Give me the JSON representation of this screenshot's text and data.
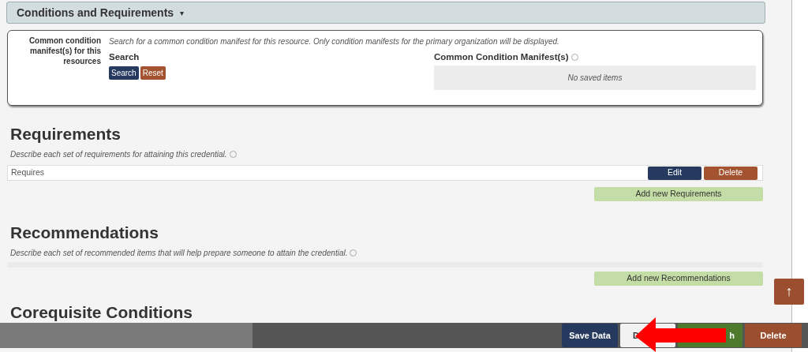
{
  "section_header": {
    "title": "Conditions and Requirements",
    "caret": "▾"
  },
  "manifest_card": {
    "label": "Common condition manifest(s) for this resources",
    "hint": "Search for a common condition manifest for this resource. Only condition manifests for the primary organization will be displayed.",
    "search_title": "Search",
    "buttons": [
      "Search",
      "Reset"
    ],
    "list_title": "Common Condition Manifest(s)",
    "empty_text": "No saved items"
  },
  "requirements": {
    "heading": "Requirements",
    "description": "Describe each set of requirements for attaining this credential.",
    "rows": [
      {
        "label": "Requires",
        "buttons": [
          "Edit",
          "Delete"
        ]
      }
    ],
    "add_button": "Add new Requirements"
  },
  "recommendations": {
    "heading": "Recommendations",
    "description": "Describe each set of recommended items that will help prepare someone to attain the credential.",
    "add_button": "Add new Recommendations"
  },
  "corequisite": {
    "heading": "Corequisite Conditions"
  },
  "scroll_top": {
    "icon": "↑"
  },
  "bottom_bar": {
    "buttons": [
      {
        "label": "Save Data",
        "kind": "save"
      },
      {
        "label": "D",
        "kind": "plain"
      },
      {
        "label": "h",
        "kind": "publish"
      },
      {
        "label": "Delete",
        "kind": "delete"
      }
    ]
  }
}
